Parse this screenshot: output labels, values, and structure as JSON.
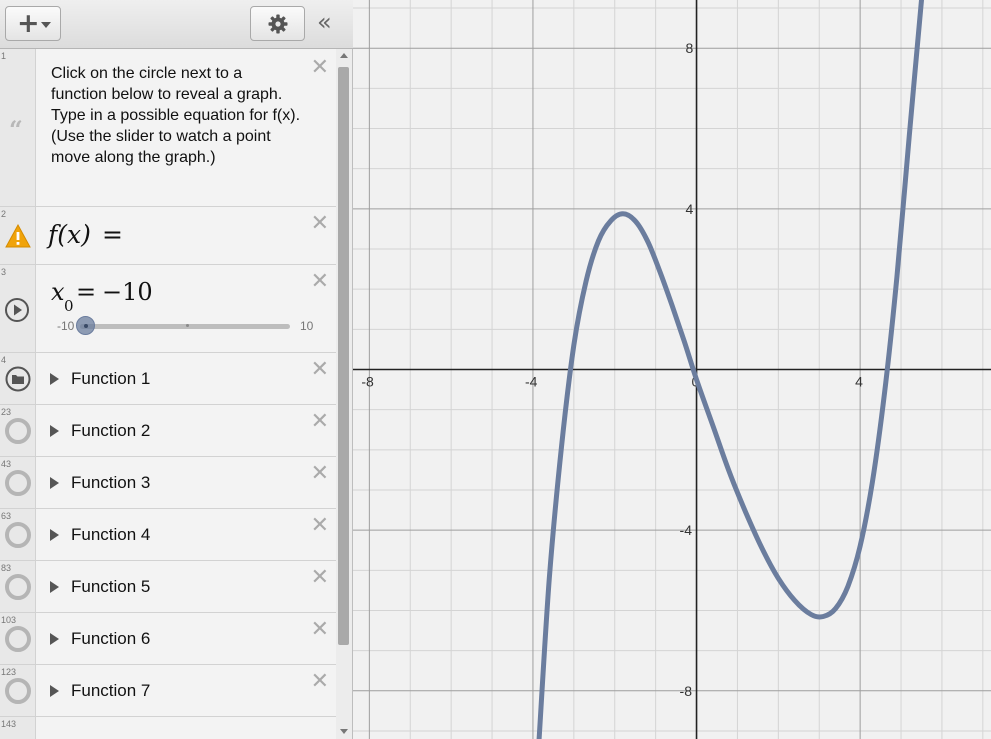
{
  "toolbar": {
    "add_icon": "plus-icon",
    "add_symbol": "+",
    "settings_icon": "gear-icon",
    "collapse_icon": "double-chevron-left-icon",
    "collapse_symbol": "«"
  },
  "expressions": [
    {
      "num": "1",
      "type": "note",
      "icon": "quote-icon",
      "icon_symbol": "“",
      "text": "Click on the circle next to a function below to reveal a graph. Type in a possible equation for f(x).  (Use the slider to watch a point move along the graph.)"
    },
    {
      "num": "2",
      "type": "expression",
      "icon": "warning-icon",
      "label": "f(x)",
      "equals": "="
    },
    {
      "num": "3",
      "type": "slider",
      "icon": "play-icon",
      "variable": "x",
      "subscript": "0",
      "equals": "=",
      "value": "−10",
      "numeric_value": -10,
      "min": "-10",
      "max": "10"
    },
    {
      "num": "4",
      "type": "folder",
      "icon": "folder-icon",
      "label": "Function 1"
    },
    {
      "num": "23",
      "type": "folder",
      "icon": "circle-icon",
      "label": "Function 2"
    },
    {
      "num": "43",
      "type": "folder",
      "icon": "circle-icon",
      "label": "Function 3"
    },
    {
      "num": "63",
      "type": "folder",
      "icon": "circle-icon",
      "label": "Function 4"
    },
    {
      "num": "83",
      "type": "folder",
      "icon": "circle-icon",
      "label": "Function 5"
    },
    {
      "num": "103",
      "type": "folder",
      "icon": "circle-icon",
      "label": "Function 6"
    },
    {
      "num": "123",
      "type": "folder",
      "icon": "circle-icon",
      "label": "Function 7"
    },
    {
      "num": "143",
      "type": "folder",
      "icon": "circle-icon",
      "label": ""
    }
  ],
  "delete_symbol": "✕",
  "colors": {
    "curve": "#6b7d9e",
    "grid_minor": "#d4d4d4",
    "grid_major": "#9e9e9e",
    "axis": "#222222",
    "warning": "#f0a30a"
  },
  "chart_data": {
    "type": "line",
    "xlim": [
      -8.4,
      7.2
    ],
    "ylim": [
      -9.2,
      9.2
    ],
    "grid": true,
    "x_ticks": [
      "-8",
      "-4",
      "0",
      "4"
    ],
    "y_ticks": [
      "8",
      "4",
      "-4",
      "-8"
    ],
    "x_tick_values": [
      -8,
      -4,
      0,
      4
    ],
    "y_tick_values": [
      8,
      4,
      -4,
      -8
    ],
    "series": [
      {
        "points": [
          [
            -3.85,
            -9.2
          ],
          [
            -3.6,
            -5.2
          ],
          [
            -3.3,
            -1.9
          ],
          [
            -3.0,
            0.6
          ],
          [
            -2.7,
            2.2
          ],
          [
            -2.4,
            3.2
          ],
          [
            -2.1,
            3.7
          ],
          [
            -1.8,
            3.88
          ],
          [
            -1.5,
            3.7
          ],
          [
            -1.2,
            3.2
          ],
          [
            -0.9,
            2.45
          ],
          [
            -0.6,
            1.6
          ],
          [
            -0.3,
            0.7
          ],
          [
            0.0,
            -0.25
          ],
          [
            0.4,
            -1.4
          ],
          [
            0.8,
            -2.55
          ],
          [
            1.2,
            -3.55
          ],
          [
            1.6,
            -4.45
          ],
          [
            2.0,
            -5.2
          ],
          [
            2.4,
            -5.75
          ],
          [
            2.8,
            -6.1
          ],
          [
            3.1,
            -6.15
          ],
          [
            3.4,
            -5.95
          ],
          [
            3.7,
            -5.4
          ],
          [
            4.0,
            -4.4
          ],
          [
            4.3,
            -2.8
          ],
          [
            4.6,
            -0.55
          ],
          [
            4.9,
            2.3
          ],
          [
            5.2,
            5.8
          ],
          [
            5.5,
            9.2
          ]
        ]
      }
    ]
  }
}
